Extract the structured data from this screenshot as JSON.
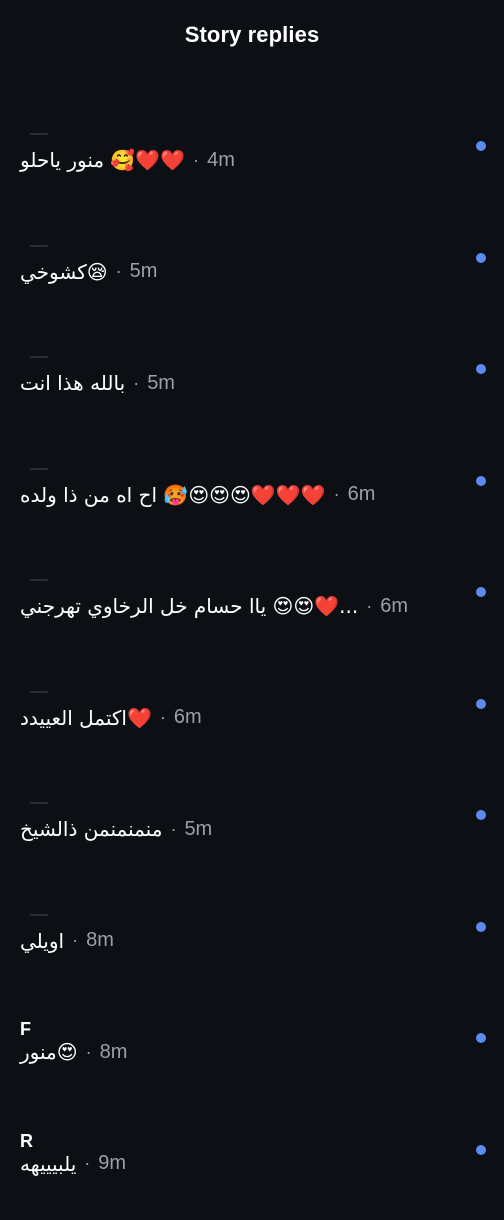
{
  "header": {
    "title": "Story replies"
  },
  "colors": {
    "background": "#0c0f13",
    "unread_dot": "#5d89f2",
    "time_text": "#9aa0a6"
  },
  "replies": [
    {
      "sender": "",
      "text": "❤️❤️🥰 منور ياحلو",
      "time": "4m",
      "unread": true
    },
    {
      "sender": "",
      "text": "😪كشوخي",
      "time": "5m",
      "unread": true
    },
    {
      "sender": "",
      "text": "بالله هذا انت",
      "time": "5m",
      "unread": true
    },
    {
      "sender": "",
      "text": "❤️❤️❤️😍😍😍🥵 اح اه من ذا ولده",
      "time": "6m",
      "unread": true
    },
    {
      "sender": "",
      "text": "...❤️😍😍 ياا حسام خل الرخاوي تهرجني",
      "time": "6m",
      "unread": true
    },
    {
      "sender": "",
      "text": "❤️اكتمل العييدد",
      "time": "6m",
      "unread": true
    },
    {
      "sender": "",
      "text": "منمنمنمن ذالشيخ",
      "time": "5m",
      "unread": true
    },
    {
      "sender": "",
      "text": "اويلي",
      "time": "8m",
      "unread": true
    },
    {
      "sender": "F",
      "text": "😍منور",
      "time": "8m",
      "unread": true
    },
    {
      "sender": "R",
      "text": "يلبيييهه",
      "time": "9m",
      "unread": true
    }
  ]
}
